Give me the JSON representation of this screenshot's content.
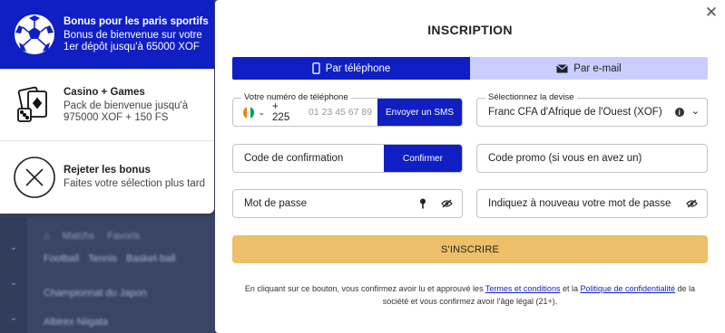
{
  "background": {
    "nav_tabs": [
      "Matchs",
      "Favoris"
    ],
    "rows": [
      "Football",
      "Tennis",
      "Basket-ball"
    ],
    "league": "Championnat du Japon",
    "team": "Albirex Niigata"
  },
  "bonuses": [
    {
      "title": "Bonus pour les paris sportifs",
      "desc": "Bonus de bienvenue sur votre 1er dépôt jusqu'à 65000 XOF",
      "icon": "soccer-ball-icon"
    },
    {
      "title": "Casino + Games",
      "desc": "Pack de bienvenue jusqu'à 975000 XOF + 150 FS",
      "icon": "cards-dice-icon"
    },
    {
      "title": "Rejeter les bonus",
      "desc": "Faites votre sélection plus tard",
      "icon": "reject-x-icon"
    }
  ],
  "modal": {
    "title": "INSCRIPTION",
    "close": "✕",
    "tabs": {
      "phone": "Par téléphone",
      "email": "Par e-mail"
    },
    "phone": {
      "legend": "Votre numéro de téléphone",
      "prefix": "+ 225",
      "placeholder": "01 23 45 67 89",
      "send_sms": "Envoyer un SMS"
    },
    "currency": {
      "legend": "Sélectionnez la devise",
      "value": "Franc CFA d'Afrique de l'Ouest (XOF)"
    },
    "code": {
      "placeholder": "Code de confirmation",
      "confirm": "Confirmer"
    },
    "promo": {
      "placeholder": "Code promo (si vous en avez un)"
    },
    "password": {
      "placeholder": "Mot de passe"
    },
    "password2": {
      "placeholder": "Indiquez à nouveau votre mot de passe"
    },
    "submit": "S'INSCRIRE",
    "legal": {
      "before": "En cliquant sur ce bouton, vous confirmez avoir lu et approuvé les ",
      "terms": "Termes et conditions",
      "middle": " et la ",
      "privacy": "Politique de confidentialité",
      "after": " de la société et vous confirmez avoir l'âge légal (21+)."
    }
  },
  "colors": {
    "primary": "#0f1fc4",
    "tab_inactive": "#c9ceff",
    "submit": "#ecbf68"
  }
}
